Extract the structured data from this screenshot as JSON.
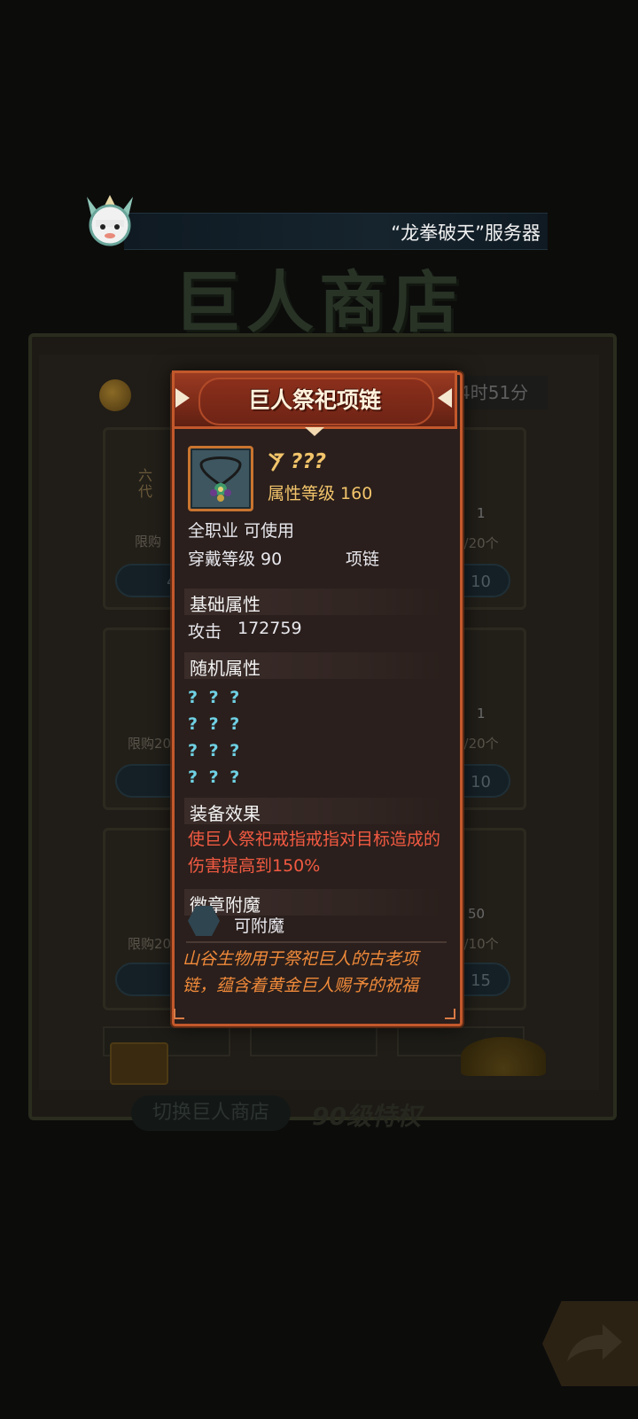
{
  "ticker": {
    "text": "“龙拳破天”服务器"
  },
  "shop": {
    "title": "巨人商店",
    "timer": "4时51分",
    "cards": {
      "left_row1_limit": "限购",
      "left_row2_limit": "限购20",
      "left_row3_limit": "限购20",
      "right_row1_limit": "0/20个",
      "right_row2_limit": "0/20个",
      "right_row3_limit": "0/10个",
      "right_row1_price": "10",
      "right_row2_price": "10",
      "right_row3_price": "15",
      "left_row1_price": "4",
      "right_row1_count": "1",
      "right_row2_count": "1",
      "right_row3_count": "50",
      "left_row1_badge": "六代"
    },
    "bottom_button": "切换巨人商店",
    "bottom_label": "90级特权"
  },
  "item": {
    "title": "巨人祭祀项链",
    "name": "???",
    "attr_level": "属性等级 160",
    "class_req": "全职业 可使用",
    "wear_level": "穿戴等级 90",
    "slot_type": "项链",
    "sections": {
      "base": "基础属性",
      "random": "随机属性",
      "effect": "装备效果",
      "enchant": "徽章附魔"
    },
    "base_stat": {
      "label": "攻击",
      "value": "172759"
    },
    "random_stats": [
      "? ? ?",
      "? ? ?",
      "? ? ?",
      "? ? ?"
    ],
    "effect_text": "使巨人祭祀戒指戒指对目标造成的伤害提高到150%",
    "enchant_text": "可附魔",
    "flavor_text": "山谷生物用于祭祀巨人的古老项链，蕴含着黄金巨人赐予的祝福"
  },
  "colors": {
    "dialog_border": "#c3582b",
    "gold_text": "#f2c46b",
    "unknown_text": "#6fd1e4",
    "effect_text": "#f25a42",
    "flavor_text": "#f08a3a"
  }
}
